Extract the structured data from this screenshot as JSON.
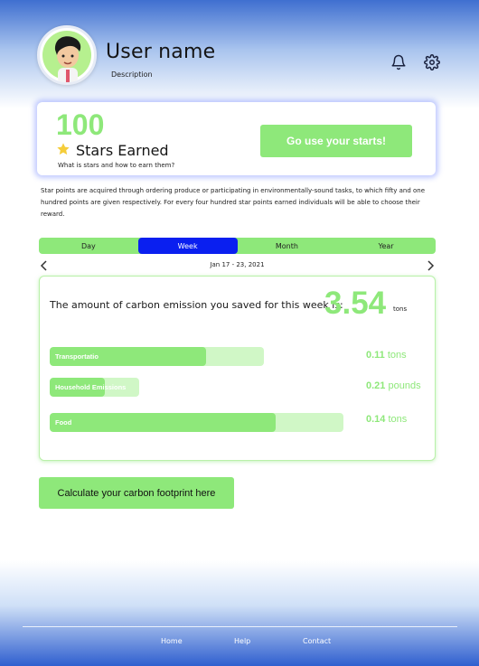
{
  "header": {
    "user_name": "User name",
    "description": "Description",
    "icons": [
      "bell-icon",
      "gear-icon"
    ]
  },
  "stars": {
    "count": "100",
    "label": "Stars Earned",
    "help": "What is stars and how to earn them?",
    "button": "Go use your starts!"
  },
  "info": "Star points are acquired through ordering produce or participating in environmentally-sound tasks, to which fifty and one hundred points are given respectively. For every four hundred star points earned individuals will be able to choose their reward.",
  "tabs": [
    "Day",
    "Week",
    "Month",
    "Year"
  ],
  "active_tab": "Week",
  "date_range": "Jan 17 - 23, 2021",
  "emissions": {
    "text": "The amount of carbon emission you saved for this week is:",
    "value": "3.54",
    "unit": "tons",
    "items": [
      {
        "label": "Transportatio",
        "value": "0.11",
        "unit": "tons",
        "fill": 0.73
      },
      {
        "label": "Household Emissions",
        "value": "0.21",
        "unit": "pounds",
        "fill": 0.62
      },
      {
        "label": "Food",
        "value": "0.14",
        "unit": "tons",
        "fill": 0.77
      }
    ]
  },
  "calc_button": "Calculate your carbon footprint here",
  "footer": {
    "links": [
      "Home",
      "Help",
      "Contact"
    ]
  },
  "colors": {
    "accent": "#8ee87a",
    "active_tab": "#0a1ff0",
    "track": "#d0f7c6"
  }
}
